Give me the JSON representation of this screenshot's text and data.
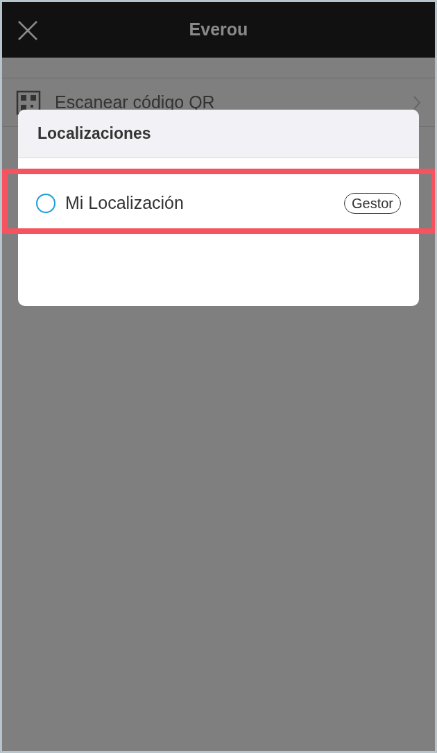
{
  "nav_bar": {
    "title": "Everou"
  },
  "background_list": [
    {
      "label": "Escanear código QR"
    }
  ],
  "dialog": {
    "title": "Localizaciones",
    "items": [
      {
        "label": "Mi Localización",
        "badge": "Gestor",
        "selected": false,
        "highlighted": true
      }
    ]
  }
}
